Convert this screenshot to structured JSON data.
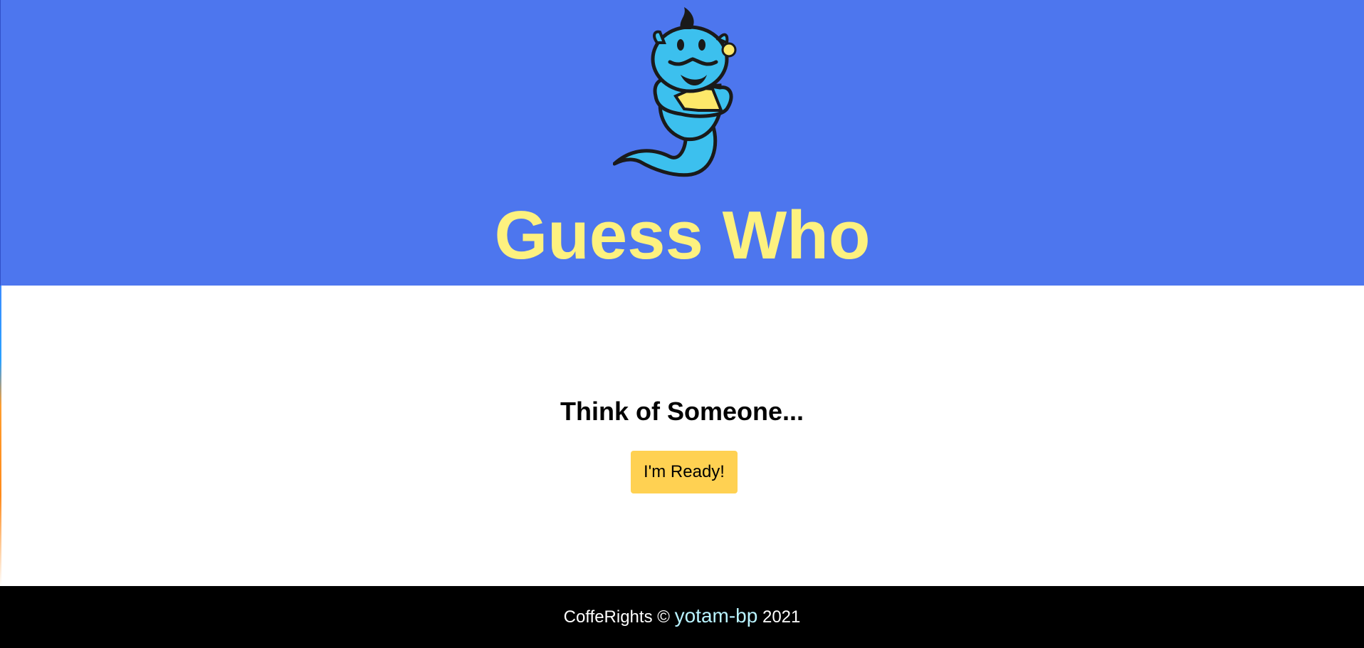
{
  "header": {
    "logo_icon": "genie-mascot-icon",
    "title": "Guess Who"
  },
  "main": {
    "prompt": "Think of Someone...",
    "ready_button_label": "I'm Ready!"
  },
  "footer": {
    "prefix": "CoffeRights ©",
    "author_link": "yotam-bp",
    "year": "2021"
  },
  "colors": {
    "header_background": "#4d76ee",
    "title": "#fdf17f",
    "button": "#ffd152",
    "footer_background": "#000000",
    "footer_link": "#b9f3ff"
  }
}
